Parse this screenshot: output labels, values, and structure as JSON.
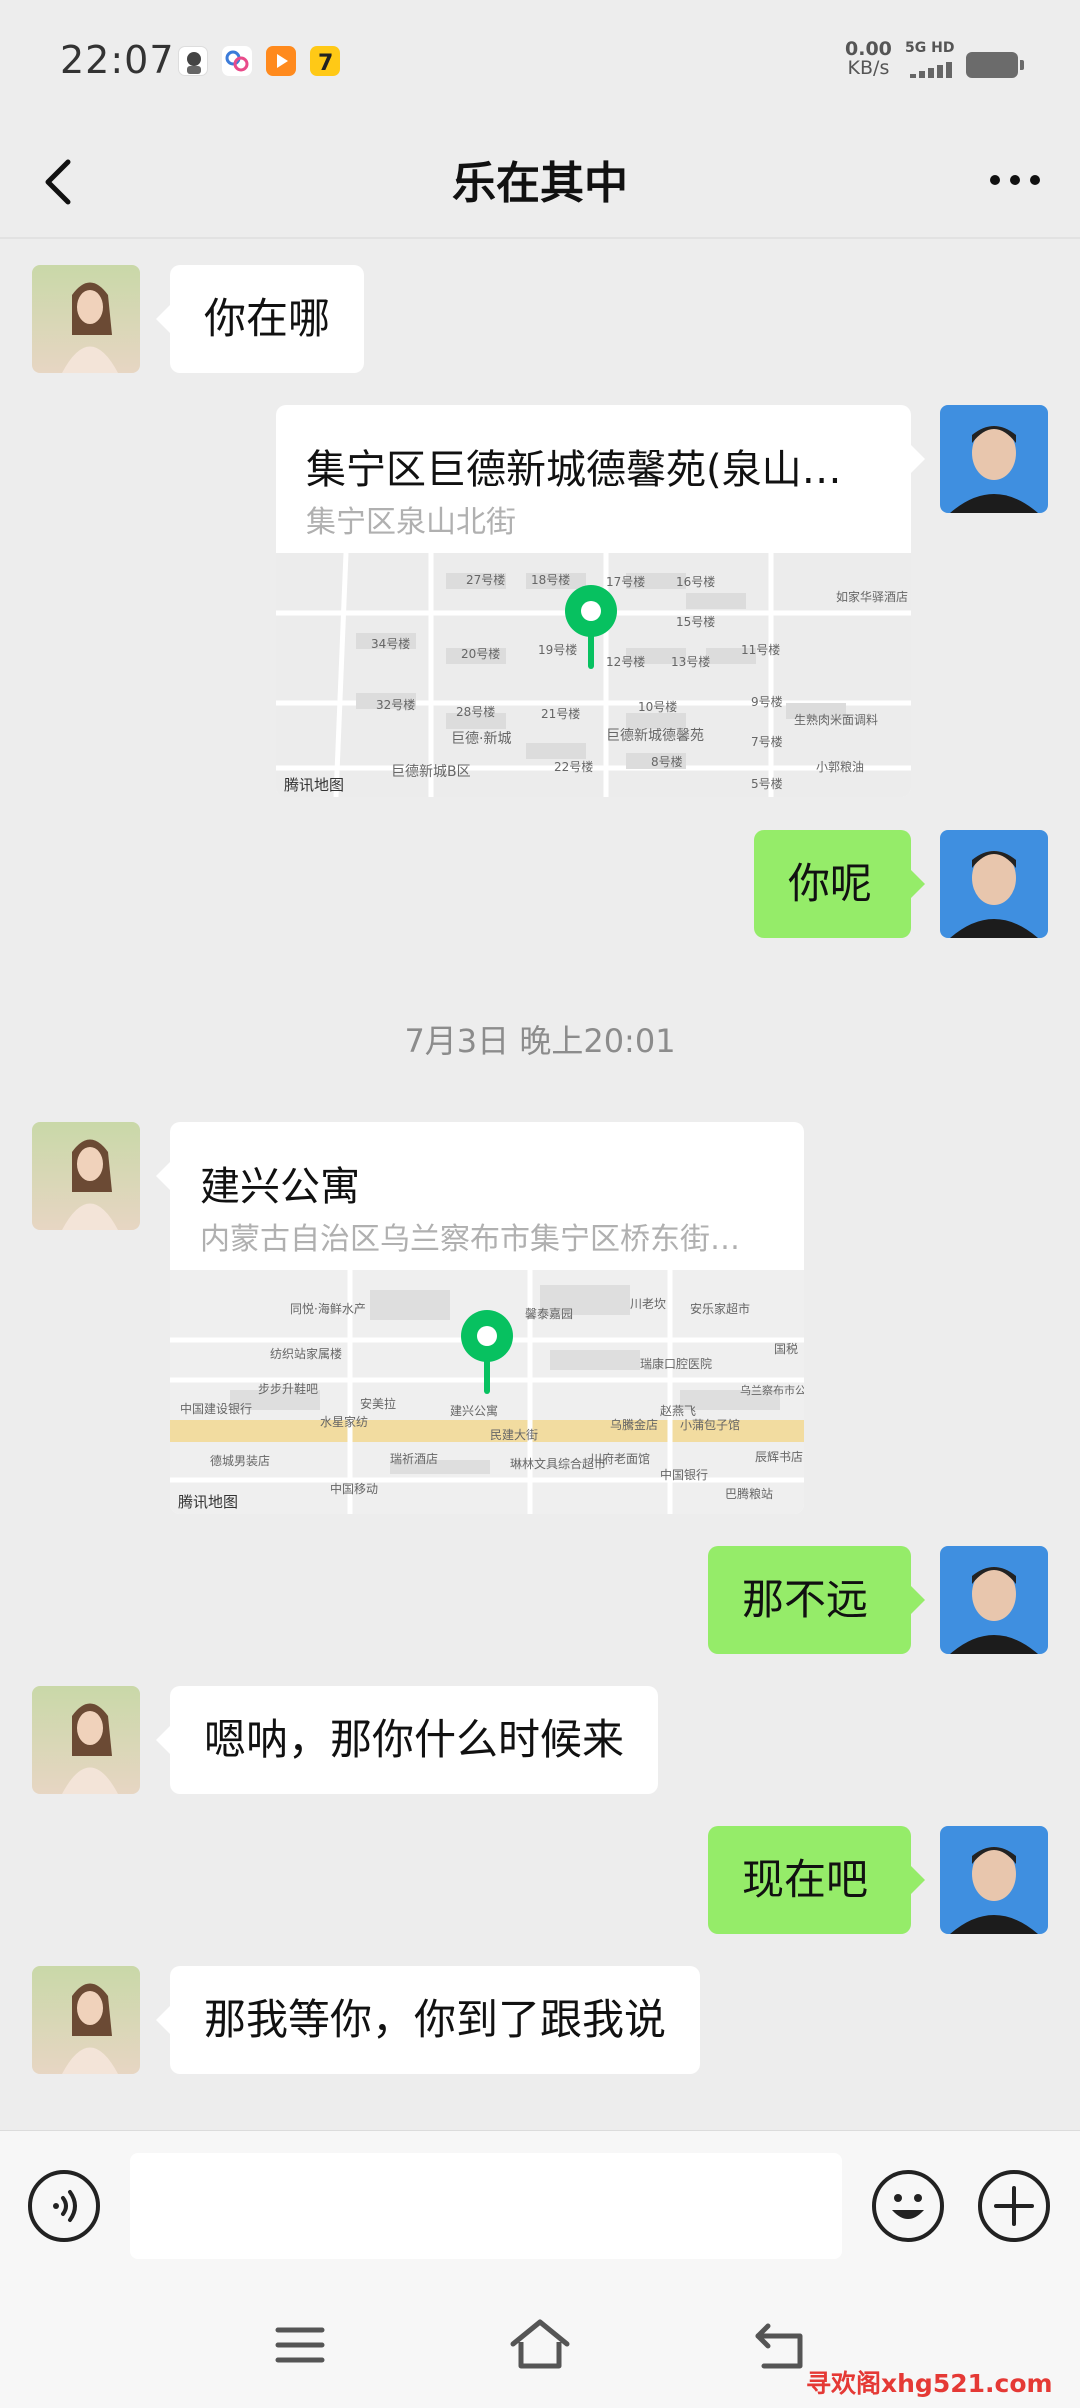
{
  "status": {
    "time": "22:07",
    "net_speed": "0.00",
    "net_unit": "KB/s",
    "signal_label": "5G HD"
  },
  "header": {
    "title": "乐在其中"
  },
  "messages": [
    {
      "side": "left",
      "type": "text",
      "text": "你在哪"
    },
    {
      "side": "right",
      "type": "location",
      "name": "集宁区巨德新城德馨苑(泉山…",
      "address": "集宁区泉山北街",
      "map_source": "腾讯地图",
      "map_labels": [
        "27号楼",
        "18号楼",
        "17号楼",
        "16号楼",
        "15号楼",
        "19号楼",
        "12号楼",
        "13号楼",
        "11号楼",
        "34号楼",
        "20号楼",
        "32号楼",
        "28号楼",
        "21号楼",
        "10号楼",
        "9号楼",
        "7号楼",
        "5号楼",
        "22号楼",
        "8号楼",
        "巨德·新城",
        "巨德新城德馨苑",
        "巨德新城B区",
        "如家华驿酒店",
        "生熟肉米面调料",
        "小郭粮油"
      ]
    },
    {
      "side": "right",
      "type": "text",
      "text": "你呢"
    },
    {
      "side": "left",
      "type": "location",
      "name": "建兴公寓",
      "address": "内蒙古自治区乌兰察布市集宁区桥东街…",
      "map_source": "腾讯地图",
      "map_labels": [
        "同悦·海鲜水产",
        "馨泰嘉园",
        "川老坎",
        "安乐家超市",
        "纺织站家属楼",
        "瑞康口腔医院",
        "国税",
        "步步升鞋吧",
        "安美拉",
        "赵燕飞",
        "乌兰察布市公证处",
        "中国建设银行",
        "水星家纺",
        "建兴公寓",
        "乌騰金店",
        "小蒲包子馆",
        "民建大街",
        "川府老面馆",
        "瑞祈酒店",
        "德城男装店",
        "琳林文具综合超市",
        "中国移动",
        "中国银行",
        "巴腾粮站",
        "辰辉书店"
      ]
    },
    {
      "side": "right",
      "type": "text",
      "text": "那不远"
    },
    {
      "side": "left",
      "type": "text",
      "text": "嗯呐，那你什么时候来"
    },
    {
      "side": "right",
      "type": "text",
      "text": "现在吧"
    },
    {
      "side": "left",
      "type": "text",
      "text": "那我等你，你到了跟我说"
    }
  ],
  "timestamp": "7月3日 晚上20:01",
  "input": {
    "value": "",
    "placeholder": ""
  },
  "icons": {
    "back": "back-arrow-icon",
    "more": "more-dots-icon",
    "voice": "voice-icon",
    "emoji": "emoji-icon",
    "plus": "plus-icon",
    "nav_menu": "menu-icon",
    "nav_home": "home-icon",
    "nav_back": "return-icon",
    "map_pin": "location-pin-icon"
  },
  "colors": {
    "background": "#ededed",
    "right_bubble": "#95ec69",
    "left_bubble": "#ffffff",
    "map_pin": "#07c160"
  },
  "watermark": "寻欢阁xhg521.com"
}
